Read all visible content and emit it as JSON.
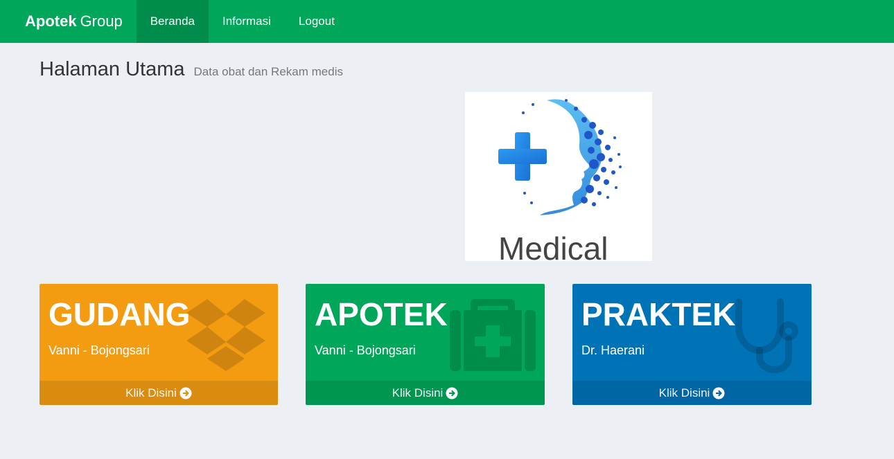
{
  "navbar": {
    "brand_bold": "Apotek",
    "brand_light": "Group",
    "items": [
      {
        "label": "Beranda",
        "active": true
      },
      {
        "label": "Informasi",
        "active": false
      },
      {
        "label": "Logout",
        "active": false
      }
    ]
  },
  "header": {
    "title": "Halaman Utama",
    "subtitle": "Data obat dan Rekam medis"
  },
  "logo": {
    "text": "Medical",
    "icon": "medical-head-cross-logo"
  },
  "boxes": [
    {
      "title": "GUDANG",
      "subtitle": "Vanni - Bojongsari",
      "footer": "Klik Disini",
      "icon": "dropbox-icon",
      "color": "#f39c12"
    },
    {
      "title": "APOTEK",
      "subtitle": "Vanni - Bojongsari",
      "footer": "Klik Disini",
      "icon": "medkit-icon",
      "color": "#00a65a"
    },
    {
      "title": "PRAKTEK",
      "subtitle": "Dr. Haerani",
      "footer": "Klik Disini",
      "icon": "stethoscope-icon",
      "color": "#0073b7"
    }
  ],
  "colors": {
    "navbar": "#00a65a",
    "navbar_active": "#008d4c",
    "background": "#ecf0f5"
  }
}
